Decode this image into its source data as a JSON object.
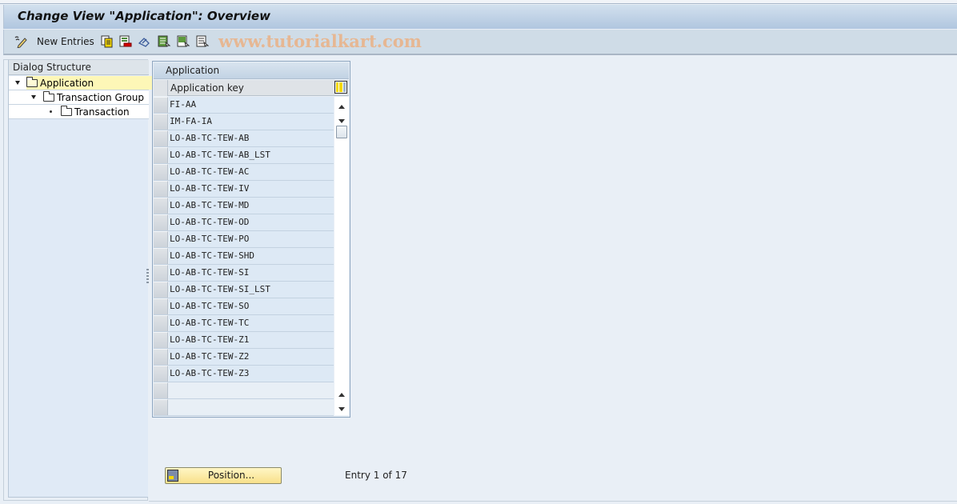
{
  "window": {
    "title": "Change View \"Application\": Overview"
  },
  "toolbar": {
    "new_entries_label": "New Entries",
    "icons": [
      "display-change-icon",
      "copy-icon",
      "delete-icon",
      "undo-icon",
      "select-all-icon",
      "select-block-icon",
      "deselect-all-icon"
    ],
    "watermark": "www.tutorialkart.com"
  },
  "dialog_structure": {
    "header": "Dialog Structure",
    "items": [
      {
        "label": "Application",
        "level": 0,
        "expanded": true,
        "selected": true
      },
      {
        "label": "Transaction Group",
        "level": 1,
        "expanded": true,
        "selected": false
      },
      {
        "label": "Transaction",
        "level": 2,
        "expanded": false,
        "selected": false
      }
    ]
  },
  "table": {
    "title": "Application",
    "column_header": "Application key",
    "rows": [
      "FI-AA",
      "IM-FA-IA",
      "LO-AB-TC-TEW-AB",
      "LO-AB-TC-TEW-AB_LST",
      "LO-AB-TC-TEW-AC",
      "LO-AB-TC-TEW-IV",
      "LO-AB-TC-TEW-MD",
      "LO-AB-TC-TEW-OD",
      "LO-AB-TC-TEW-PO",
      "LO-AB-TC-TEW-SHD",
      "LO-AB-TC-TEW-SI",
      "LO-AB-TC-TEW-SI_LST",
      "LO-AB-TC-TEW-SO",
      "LO-AB-TC-TEW-TC",
      "LO-AB-TC-TEW-Z1",
      "LO-AB-TC-TEW-Z2",
      "LO-AB-TC-TEW-Z3",
      "",
      ""
    ]
  },
  "footer": {
    "position_button_label": "Position...",
    "entry_info": "Entry 1 of 17"
  }
}
